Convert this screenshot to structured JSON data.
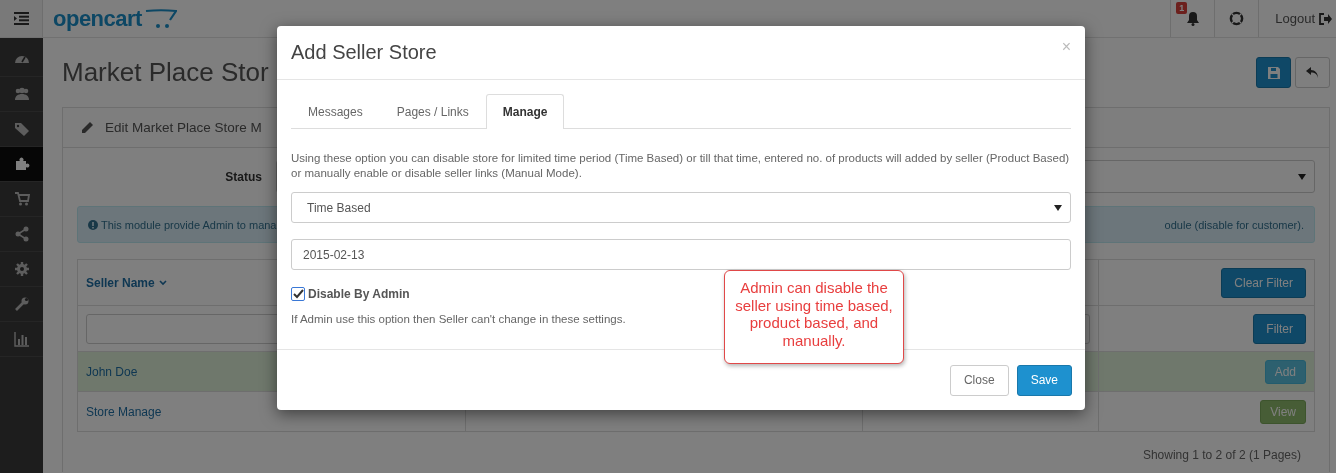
{
  "header": {
    "logo": "opencart",
    "notification_count": "1",
    "logout": "Logout"
  },
  "sidebar": {
    "items": [
      {
        "kind": "dashboard",
        "selected": false
      },
      {
        "kind": "users",
        "selected": false
      },
      {
        "kind": "tags",
        "selected": false
      },
      {
        "kind": "puzzle",
        "selected": true
      },
      {
        "kind": "cart",
        "selected": false
      },
      {
        "kind": "share",
        "selected": false
      },
      {
        "kind": "gear",
        "selected": false
      },
      {
        "kind": "wrench",
        "selected": false
      },
      {
        "kind": "chart",
        "selected": false
      }
    ]
  },
  "page": {
    "title": "Market Place Stor"
  },
  "panel": {
    "heading": "Edit Market Place Store M",
    "status_label": "Status",
    "alert": [
      "This module provide Admin to mana",
      "odule (disable for customer)."
    ]
  },
  "table": {
    "seller_column": {
      "label": "Seller Name",
      "sorted": true
    },
    "clear_filter": "Clear Filter",
    "filter": "Filter",
    "rows": [
      {
        "seller": "John Doe",
        "action": "Add",
        "kind": "add",
        "highlighted": true
      },
      {
        "seller": "Store Manage",
        "action": "View",
        "kind": "view",
        "highlighted": false
      }
    ]
  },
  "pagination": "Showing 1 to 2 of 2 (1 Pages)",
  "modal": {
    "title": "Add Seller Store",
    "close": "×",
    "tabs": [
      {
        "label": "Messages",
        "selected": false
      },
      {
        "label": "Pages / Links",
        "selected": false
      },
      {
        "label": "Manage",
        "selected": true
      }
    ],
    "description": "Using these option you can disable store for limited time period (Time Based) or till that time, entered no. of products will added by seller (Product Based) or manually enable or disable seller links (Manual Mode).",
    "mode_select": {
      "value": "Time Based"
    },
    "date_field": {
      "value": "2015-02-13"
    },
    "disable_by_admin": {
      "label": "Disable By Admin",
      "checked": true
    },
    "help": "If Admin use this option then Seller can't change in these settings.",
    "buttons": [
      {
        "label": "Close",
        "kind": "default"
      },
      {
        "label": "Save",
        "kind": "primary"
      }
    ]
  },
  "callout": {
    "text": "Admin can disable the seller using time based, product based, and manually."
  }
}
